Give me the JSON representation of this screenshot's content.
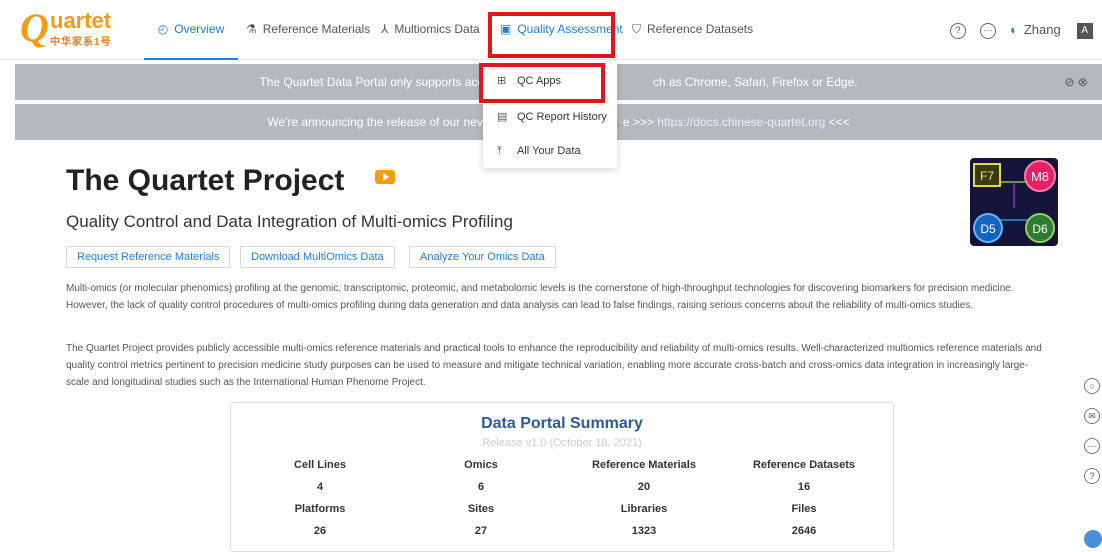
{
  "logo": {
    "letter": "Q",
    "word": "uartet",
    "subtitle": "中华家系1号"
  },
  "nav": {
    "items": [
      {
        "label": "Overview",
        "icon": "dashboard-icon"
      },
      {
        "label": "Reference Materials",
        "icon": "flask-icon"
      },
      {
        "label": "Multiomics Data",
        "icon": "network-icon"
      },
      {
        "label": "Quality Assessment",
        "icon": "calendar-icon"
      },
      {
        "label": "Reference Datasets",
        "icon": "shield-icon"
      }
    ],
    "user": "Zhang"
  },
  "banners": {
    "support": "The Quartet Data Portal only supports access fr",
    "support_tail": "ch as  Chrome,  Safari,  Firefox or  Edge.",
    "release_head": "We're announcing the release of our nev",
    "release_mid": "e >>> ",
    "release_link": "https://docs.chinese-quartet.org",
    "release_tail": " <<<"
  },
  "dropdown": {
    "items": [
      {
        "label": "QC Apps",
        "icon": "apps-grid-icon"
      },
      {
        "label": "QC Report History",
        "icon": "report-icon"
      },
      {
        "label": "All Your Data",
        "icon": "upload-icon"
      }
    ]
  },
  "main": {
    "title": "The Quartet Project",
    "subtitle": "Quality Control and Data Integration of Multi-omics Profiling",
    "buttons": [
      "Request Reference Materials",
      "Download MultiOmics Data",
      "Analyze Your Omics Data"
    ],
    "para1": "Multi-omics (or molecular phenomics) profiling at the genomic, transcriptomic, proteomic, and metabolomic levels is the cornerstone of high-throughput technologies for discovering biomarkers for precision medicine. However, the lack of quality control procedures of multi-omics profiling during data generation and data analysis can lead to false findings, raising serious concerns about the reliability of multi-omics studies.",
    "para2": "The Quartet Project provides publicly accessible multi-omics reference materials and practical tools to enhance the reproducibility and reliability of multi-omics results. Well-characterized multiomics reference materials and quality control metrics pertinent to precision medicine study purposes can be used to measure and mitigate technical variation, enabling more accurate cross-batch and cross-omics data integration in increasingly large-scale and longitudinal studies such as the International Human Phenome Project.",
    "art_labels": [
      "F7",
      "M8",
      "D5",
      "D6"
    ]
  },
  "summary": {
    "title": "Data Portal Summary",
    "release": "Release v1.0 (October 18, 2021)",
    "row1_headers": [
      "Cell Lines",
      "Omics",
      "Reference Materials",
      "Reference Datasets"
    ],
    "row1_values": [
      "4",
      "6",
      "20",
      "16"
    ],
    "row2_headers": [
      "Platforms",
      "Sites",
      "Libraries",
      "Files"
    ],
    "row2_values": [
      "26",
      "27",
      "1323",
      "2646"
    ]
  }
}
